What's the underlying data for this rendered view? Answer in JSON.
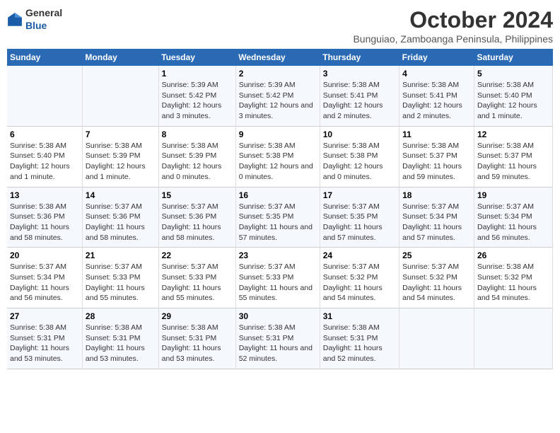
{
  "header": {
    "logo_general": "General",
    "logo_blue": "Blue",
    "month": "October 2024",
    "location": "Bunguiao, Zamboanga Peninsula, Philippines"
  },
  "weekdays": [
    "Sunday",
    "Monday",
    "Tuesday",
    "Wednesday",
    "Thursday",
    "Friday",
    "Saturday"
  ],
  "weeks": [
    [
      {
        "day": "",
        "info": ""
      },
      {
        "day": "",
        "info": ""
      },
      {
        "day": "1",
        "info": "Sunrise: 5:39 AM\nSunset: 5:42 PM\nDaylight: 12 hours and 3 minutes."
      },
      {
        "day": "2",
        "info": "Sunrise: 5:39 AM\nSunset: 5:42 PM\nDaylight: 12 hours and 3 minutes."
      },
      {
        "day": "3",
        "info": "Sunrise: 5:38 AM\nSunset: 5:41 PM\nDaylight: 12 hours and 2 minutes."
      },
      {
        "day": "4",
        "info": "Sunrise: 5:38 AM\nSunset: 5:41 PM\nDaylight: 12 hours and 2 minutes."
      },
      {
        "day": "5",
        "info": "Sunrise: 5:38 AM\nSunset: 5:40 PM\nDaylight: 12 hours and 1 minute."
      }
    ],
    [
      {
        "day": "6",
        "info": "Sunrise: 5:38 AM\nSunset: 5:40 PM\nDaylight: 12 hours and 1 minute."
      },
      {
        "day": "7",
        "info": "Sunrise: 5:38 AM\nSunset: 5:39 PM\nDaylight: 12 hours and 1 minute."
      },
      {
        "day": "8",
        "info": "Sunrise: 5:38 AM\nSunset: 5:39 PM\nDaylight: 12 hours and 0 minutes."
      },
      {
        "day": "9",
        "info": "Sunrise: 5:38 AM\nSunset: 5:38 PM\nDaylight: 12 hours and 0 minutes."
      },
      {
        "day": "10",
        "info": "Sunrise: 5:38 AM\nSunset: 5:38 PM\nDaylight: 12 hours and 0 minutes."
      },
      {
        "day": "11",
        "info": "Sunrise: 5:38 AM\nSunset: 5:37 PM\nDaylight: 11 hours and 59 minutes."
      },
      {
        "day": "12",
        "info": "Sunrise: 5:38 AM\nSunset: 5:37 PM\nDaylight: 11 hours and 59 minutes."
      }
    ],
    [
      {
        "day": "13",
        "info": "Sunrise: 5:38 AM\nSunset: 5:36 PM\nDaylight: 11 hours and 58 minutes."
      },
      {
        "day": "14",
        "info": "Sunrise: 5:37 AM\nSunset: 5:36 PM\nDaylight: 11 hours and 58 minutes."
      },
      {
        "day": "15",
        "info": "Sunrise: 5:37 AM\nSunset: 5:36 PM\nDaylight: 11 hours and 58 minutes."
      },
      {
        "day": "16",
        "info": "Sunrise: 5:37 AM\nSunset: 5:35 PM\nDaylight: 11 hours and 57 minutes."
      },
      {
        "day": "17",
        "info": "Sunrise: 5:37 AM\nSunset: 5:35 PM\nDaylight: 11 hours and 57 minutes."
      },
      {
        "day": "18",
        "info": "Sunrise: 5:37 AM\nSunset: 5:34 PM\nDaylight: 11 hours and 57 minutes."
      },
      {
        "day": "19",
        "info": "Sunrise: 5:37 AM\nSunset: 5:34 PM\nDaylight: 11 hours and 56 minutes."
      }
    ],
    [
      {
        "day": "20",
        "info": "Sunrise: 5:37 AM\nSunset: 5:34 PM\nDaylight: 11 hours and 56 minutes."
      },
      {
        "day": "21",
        "info": "Sunrise: 5:37 AM\nSunset: 5:33 PM\nDaylight: 11 hours and 55 minutes."
      },
      {
        "day": "22",
        "info": "Sunrise: 5:37 AM\nSunset: 5:33 PM\nDaylight: 11 hours and 55 minutes."
      },
      {
        "day": "23",
        "info": "Sunrise: 5:37 AM\nSunset: 5:33 PM\nDaylight: 11 hours and 55 minutes."
      },
      {
        "day": "24",
        "info": "Sunrise: 5:37 AM\nSunset: 5:32 PM\nDaylight: 11 hours and 54 minutes."
      },
      {
        "day": "25",
        "info": "Sunrise: 5:37 AM\nSunset: 5:32 PM\nDaylight: 11 hours and 54 minutes."
      },
      {
        "day": "26",
        "info": "Sunrise: 5:38 AM\nSunset: 5:32 PM\nDaylight: 11 hours and 54 minutes."
      }
    ],
    [
      {
        "day": "27",
        "info": "Sunrise: 5:38 AM\nSunset: 5:31 PM\nDaylight: 11 hours and 53 minutes."
      },
      {
        "day": "28",
        "info": "Sunrise: 5:38 AM\nSunset: 5:31 PM\nDaylight: 11 hours and 53 minutes."
      },
      {
        "day": "29",
        "info": "Sunrise: 5:38 AM\nSunset: 5:31 PM\nDaylight: 11 hours and 53 minutes."
      },
      {
        "day": "30",
        "info": "Sunrise: 5:38 AM\nSunset: 5:31 PM\nDaylight: 11 hours and 52 minutes."
      },
      {
        "day": "31",
        "info": "Sunrise: 5:38 AM\nSunset: 5:31 PM\nDaylight: 11 hours and 52 minutes."
      },
      {
        "day": "",
        "info": ""
      },
      {
        "day": "",
        "info": ""
      }
    ]
  ]
}
